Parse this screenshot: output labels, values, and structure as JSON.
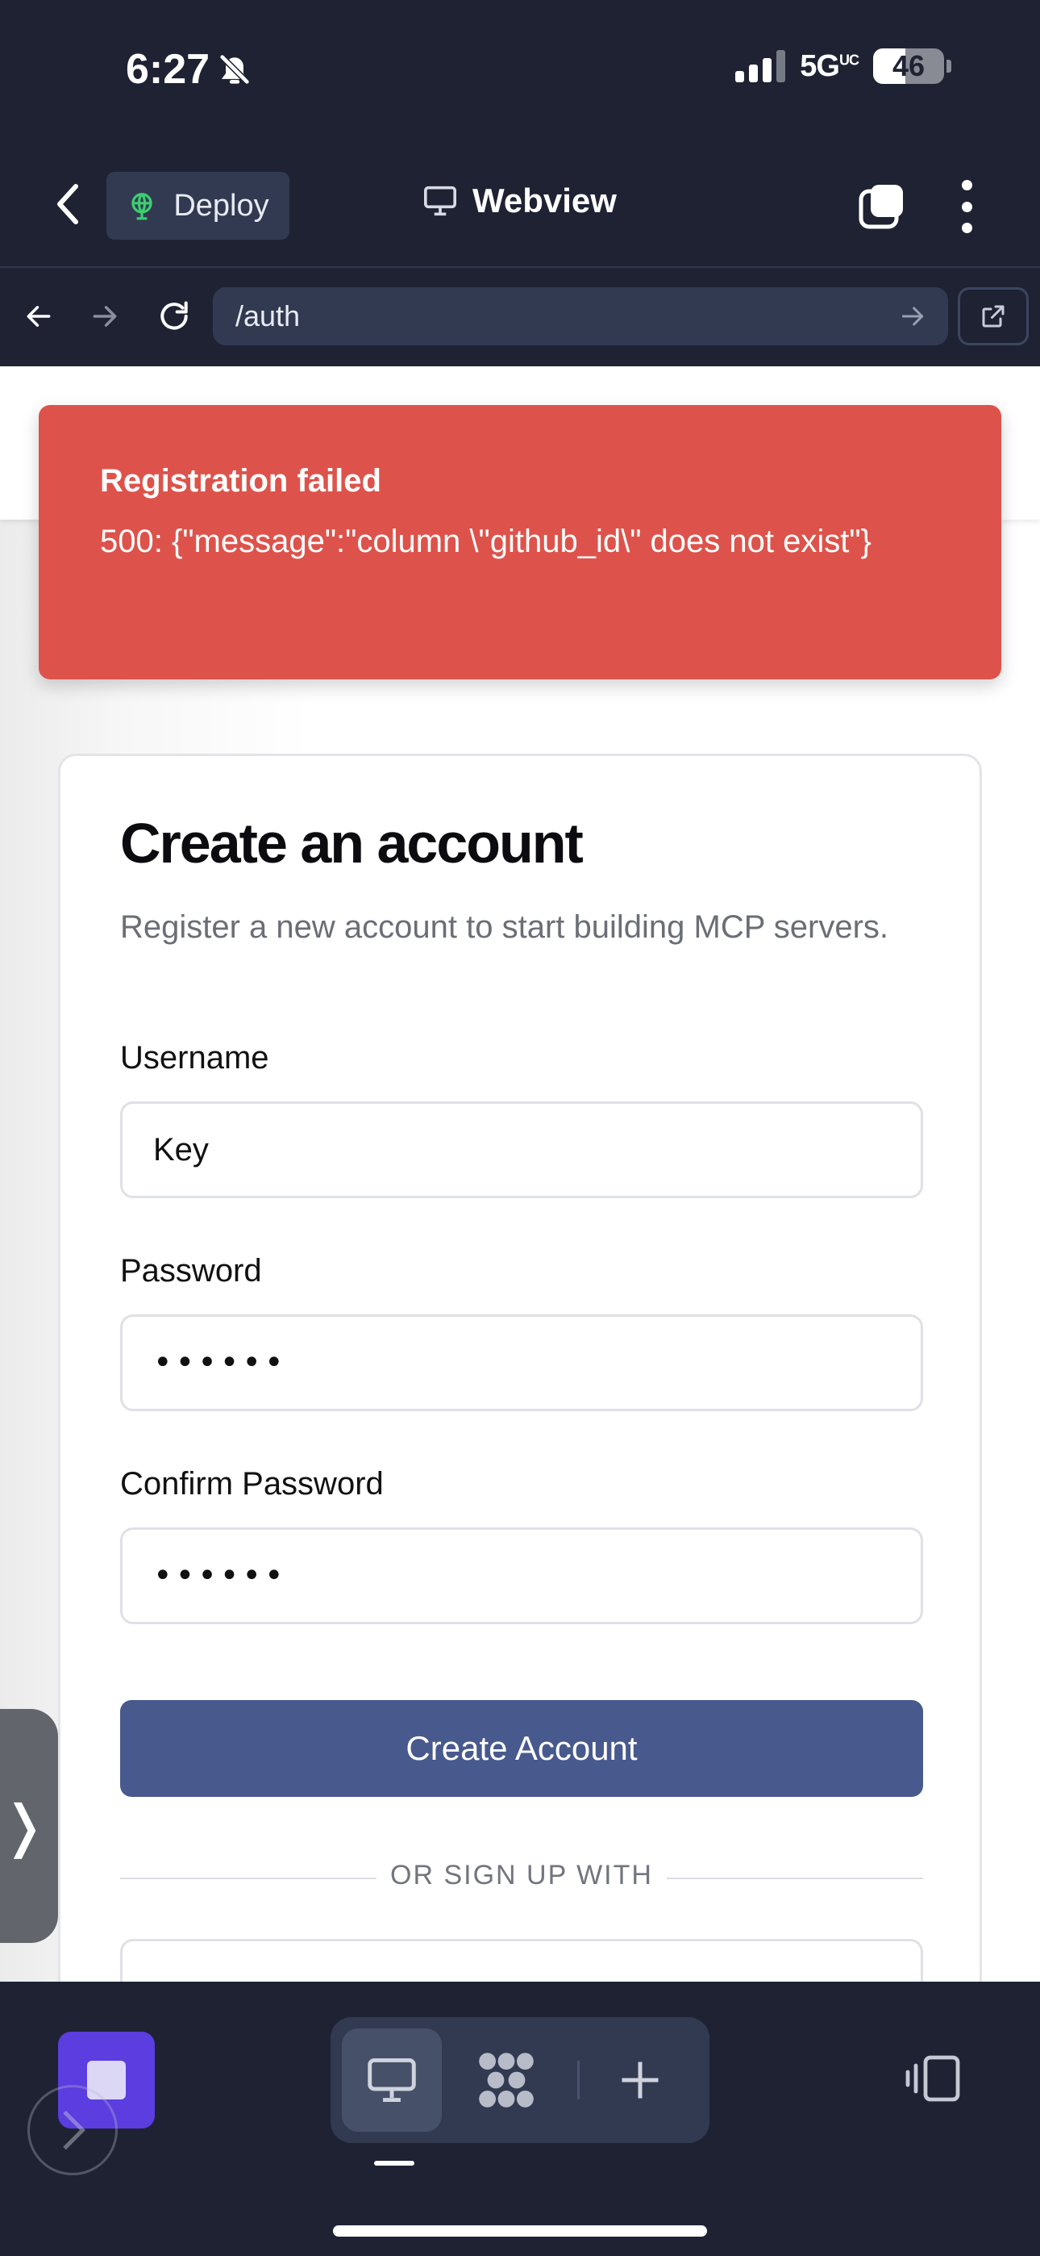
{
  "status_bar": {
    "time": "6:27",
    "network": "5G",
    "network_sup": "UC",
    "battery": "46",
    "battery_level_percent": 46
  },
  "header": {
    "deploy_label": "Deploy",
    "title": "Webview"
  },
  "url_bar": {
    "url": "/auth"
  },
  "toast": {
    "title": "Registration failed",
    "message": "500: {\"message\":\"column \\\"github_id\\\" does not exist\"}"
  },
  "form": {
    "title": "Create an account",
    "subtitle": "Register a new account to start building MCP servers.",
    "username_label": "Username",
    "username_value": "Key",
    "password_label": "Password",
    "password_value": "••••••",
    "confirm_label": "Confirm Password",
    "confirm_value": "••••••",
    "submit_label": "Create Account",
    "divider_text": "OR SIGN UP WITH"
  },
  "side_handle": {
    "glyph": "❭"
  },
  "colors": {
    "chrome_bg": "#1e2233",
    "chrome_surface": "#323a52",
    "toast_bg": "#dd534b",
    "primary_button": "#48598e",
    "app_tile": "#5b3de0"
  },
  "icons": {
    "status": [
      "bell-slash-icon",
      "signal-icon",
      "battery-icon"
    ],
    "header": [
      "chevron-left-icon",
      "globe-icon",
      "monitor-icon",
      "tabs-icon",
      "more-vertical-icon"
    ],
    "url_bar": [
      "arrow-left-icon",
      "arrow-right-icon",
      "reload-icon",
      "go-arrow-icon",
      "external-link-icon"
    ],
    "bottom": [
      "monitor-icon",
      "grid-dots-icon",
      "plus-icon",
      "side-panel-icon"
    ]
  }
}
